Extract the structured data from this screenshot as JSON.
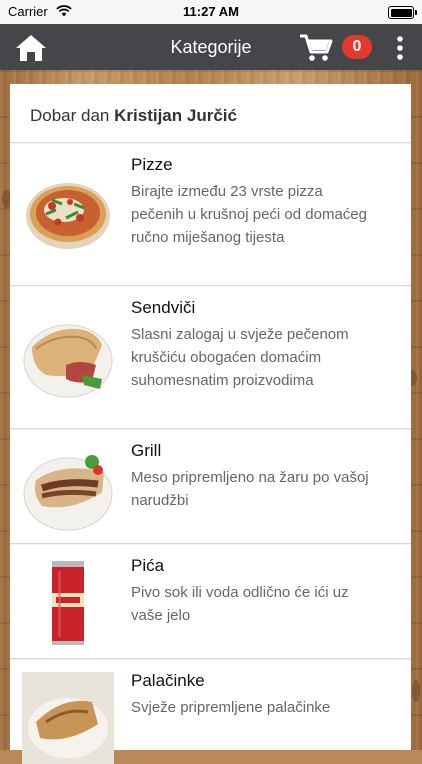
{
  "status_bar": {
    "carrier": "Carrier",
    "time": "11:27 AM"
  },
  "nav": {
    "title": "Kategorije",
    "cart_count": "0"
  },
  "greeting": {
    "prefix": "Dobar dan",
    "name": "Kristijan Jurčić"
  },
  "categories": [
    {
      "name": "Pizze",
      "description": "Birajte između 23 vrste pizza pečenih u krušnoj peći od domaćeg ručno miješanog tijesta"
    },
    {
      "name": "Sendviči",
      "description": "Slasni zalogaj u svježe pečenom kruščiću obogaćen domaćim suhomesnatim proizvodima"
    },
    {
      "name": "Grill",
      "description": "Meso pripremljeno na žaru po vašoj narudžbi"
    },
    {
      "name": "Pića",
      "description": "Pivo sok ili voda odlično će ići uz vaše jelo"
    },
    {
      "name": "Palačinke",
      "description": "Svježe pripremljene palačinke"
    }
  ],
  "colors": {
    "nav_bg": "#45464a",
    "badge": "#e23a2f"
  },
  "icons": [
    "wifi-icon",
    "battery-icon",
    "home-icon",
    "cart-icon",
    "more-vertical-icon"
  ]
}
